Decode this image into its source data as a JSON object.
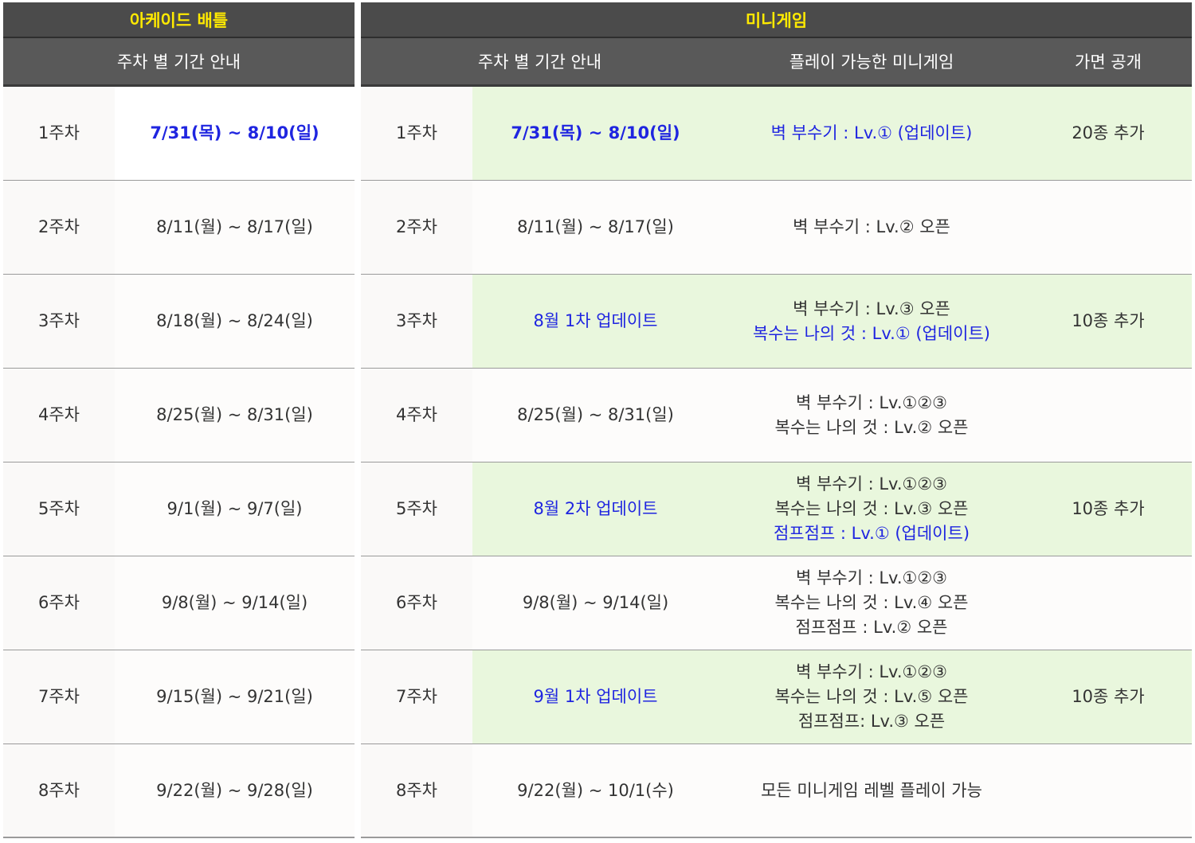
{
  "left": {
    "title": "아케이드 배틀",
    "col_header": "주차 별 기간 안내",
    "rows": [
      {
        "week": "1주차",
        "period": "7/31(목) ~ 8/10(일)"
      },
      {
        "week": "2주차",
        "period": "8/11(월) ~ 8/17(일)"
      },
      {
        "week": "3주차",
        "period": "8/18(월) ~ 8/24(일)"
      },
      {
        "week": "4주차",
        "period": "8/25(월) ~ 8/31(일)"
      },
      {
        "week": "5주차",
        "period": "9/1(월) ~ 9/7(일)"
      },
      {
        "week": "6주차",
        "period": "9/8(월) ~ 9/14(일)"
      },
      {
        "week": "7주차",
        "period": "9/15(월) ~ 9/21(일)"
      },
      {
        "week": "8주차",
        "period": "9/22(월) ~ 9/28(일)"
      }
    ]
  },
  "right": {
    "title": "미니게임",
    "col_period": "주차 별 기간 안내",
    "col_games": "플레이 가능한 미니게임",
    "col_mask": "가면 공개",
    "rows": [
      {
        "week": "1주차",
        "period": "7/31(목) ~ 8/10(일)",
        "games": [
          "벽 부수기 : Lv.① (업데이트)"
        ],
        "mask": "20종 추가"
      },
      {
        "week": "2주차",
        "period": "8/11(월) ~ 8/17(일)",
        "games": [
          "벽 부수기 : Lv.② 오픈"
        ],
        "mask": ""
      },
      {
        "week": "3주차",
        "period": "8월 1차 업데이트",
        "games": [
          "벽 부수기 : Lv.③ 오픈",
          "복수는 나의 것 : Lv.① (업데이트)"
        ],
        "mask": "10종 추가"
      },
      {
        "week": "4주차",
        "period": "8/25(월) ~ 8/31(일)",
        "games": [
          "벽 부수기 : Lv.①②③",
          "복수는 나의 것 : Lv.② 오픈"
        ],
        "mask": ""
      },
      {
        "week": "5주차",
        "period": "8월 2차 업데이트",
        "games": [
          "벽 부수기 : Lv.①②③",
          "복수는 나의 것 : Lv.③ 오픈",
          "점프점프 : Lv.① (업데이트)"
        ],
        "mask": "10종 추가"
      },
      {
        "week": "6주차",
        "period": "9/8(월) ~ 9/14(일)",
        "games": [
          "벽 부수기 : Lv.①②③",
          "복수는 나의 것 : Lv.④ 오픈",
          "점프점프 : Lv.② 오픈"
        ],
        "mask": ""
      },
      {
        "week": "7주차",
        "period": "9월 1차 업데이트",
        "games": [
          "벽 부수기 : Lv.①②③",
          "복수는 나의 것 : Lv.⑤ 오픈",
          "점프점프: Lv.③ 오픈"
        ],
        "mask": "10종 추가"
      },
      {
        "week": "8주차",
        "period": "9/22(월) ~ 10/1(수)",
        "games": [
          "모든 미니게임 레벨 플레이 가능"
        ],
        "mask": ""
      }
    ]
  },
  "colors": {
    "header_dark": "#4b4b4b",
    "header_title_text": "#ffea00",
    "highlight_green": "#e9f7dd",
    "accent_blue": "#1f25e0"
  }
}
